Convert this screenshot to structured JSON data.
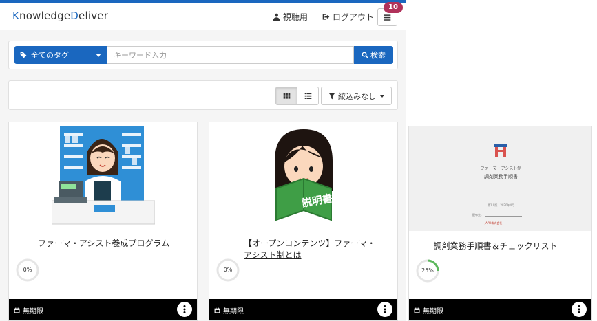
{
  "header": {
    "logo_k": "K",
    "logo_mid": "nowledge",
    "logo_d": "D",
    "logo_end": "eliver",
    "user_name": "視聴用",
    "logout_label": "ログアウト",
    "badge_count": "10"
  },
  "search": {
    "tag_label": "全てのタグ",
    "placeholder": "キーワード入力",
    "value": "",
    "search_label": "検索"
  },
  "toolbar": {
    "filter_label": "絞込みなし"
  },
  "cards": [
    {
      "title": "ファーマ・アシスト養成プログラム",
      "progress_label": "0%",
      "progress": 0,
      "expiry": "無期限"
    },
    {
      "title_line1": "【オープンコンテンツ】ファーマ・",
      "title_line2": "アシスト制とは",
      "progress_label": "0%",
      "progress": 0,
      "expiry": "無期限"
    },
    {
      "title": "調剤業務手順書＆チェックリスト",
      "progress_label": "25%",
      "progress": 25,
      "expiry": "無期限",
      "doc_subtitle": "ファーマ・アシスト制",
      "doc_title": "調剤業務手順書",
      "doc_date": "第1.0版　2020年4月",
      "doc_field": "配布先：",
      "doc_company": "JAPH株式会社"
    }
  ],
  "colors": {
    "primary": "#1a67bf",
    "badge": "#b0325a",
    "progress_ring": "#5cb85c",
    "track": "#e5e5e5"
  }
}
